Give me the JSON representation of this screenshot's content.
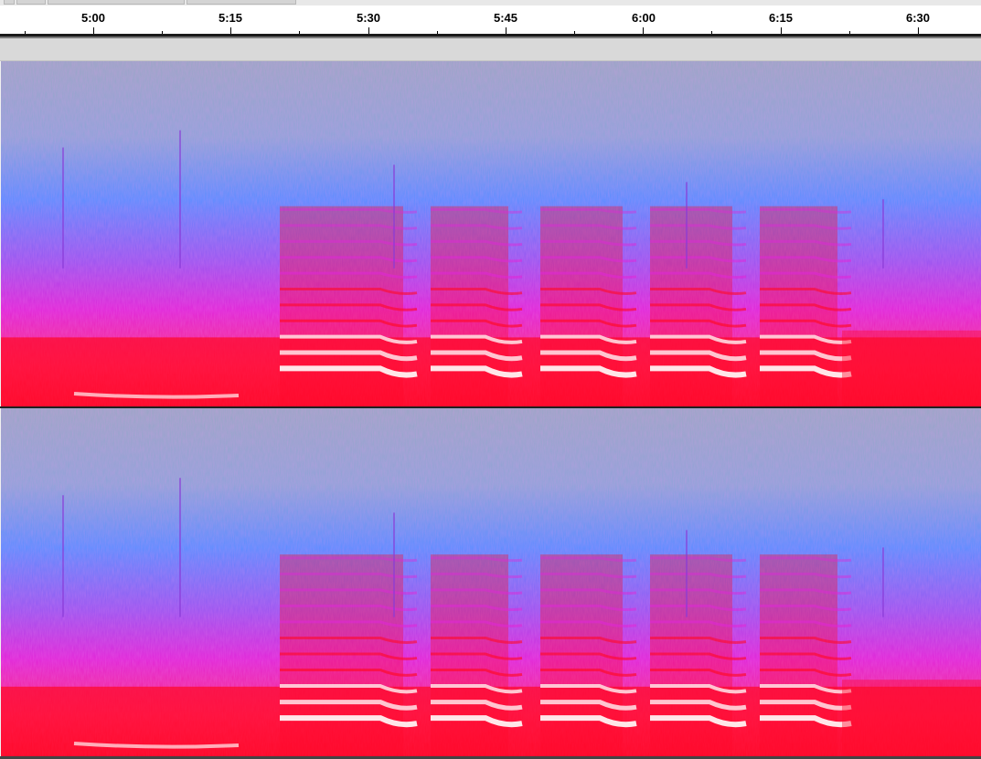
{
  "timeline": {
    "labels": [
      "5:00",
      "5:15",
      "5:30",
      "5:45",
      "6:00",
      "6:15",
      "6:30"
    ]
  },
  "tracks": [
    {
      "name": "spectrogram-channel-1"
    },
    {
      "name": "spectrogram-channel-2"
    }
  ],
  "colors": {
    "high": "#ff0a2a",
    "mid": "#e026d8",
    "low": "#5c8dff",
    "background": "#9aa6c6",
    "peak": "#fff2f2"
  }
}
